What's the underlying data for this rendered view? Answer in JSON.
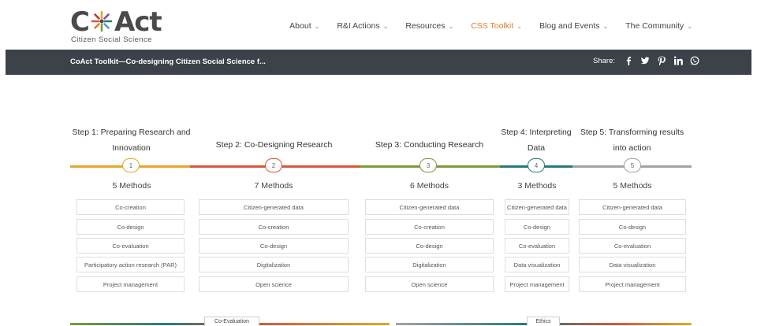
{
  "brand": {
    "name_pre": "C",
    "name_post": "Act",
    "subtitle": "Citizen Social Science"
  },
  "nav": [
    {
      "label": "About",
      "active": false
    },
    {
      "label": "R&I Actions",
      "active": false
    },
    {
      "label": "Resources",
      "active": false
    },
    {
      "label": "CSS Toolkit",
      "active": true
    },
    {
      "label": "Blog and Events",
      "active": false
    },
    {
      "label": "The Community",
      "active": false
    }
  ],
  "bar": {
    "title": "CoAct Toolkit—Co-designing Citizen Social Science f...",
    "share_label": "Share:",
    "share_icons": [
      "facebook-icon",
      "twitter-icon",
      "pinterest-icon",
      "linkedin-icon",
      "whatsapp-icon"
    ]
  },
  "steps": [
    {
      "title": "Step 1: Preparing Research and Innovation",
      "number": "1",
      "color": "#e3a82b",
      "methods": "5 Methods",
      "items": [
        "Co-creation",
        "Co-design",
        "Co-evaluation",
        "Participatory action research (PAR)",
        "Project management"
      ]
    },
    {
      "title": "Step 2: Co-Designing Research",
      "number": "2",
      "color": "#d9573b",
      "methods": "7 Methods",
      "items": [
        "Citizen-generated data",
        "Co-creation",
        "Co-design",
        "Digitalization",
        "Open science"
      ]
    },
    {
      "title": "Step 3: Conducting Research",
      "number": "3",
      "color": "#7d9a3c",
      "methods": "6 Methods",
      "items": [
        "Citizen-generated data",
        "Co-creation",
        "Co-design",
        "Digitalization",
        "Open science"
      ]
    },
    {
      "title": "Step 4: Interpreting Data",
      "number": "4",
      "color": "#2b7878",
      "methods": "3 Methods",
      "items": [
        "Citizen-generated data",
        "Co-design",
        "Co-evaluation",
        "Data visualization",
        "Project management"
      ]
    },
    {
      "title": "Step 5: Transforming results into action",
      "number": "5",
      "color": "#a3a3a3",
      "methods": "5 Methods",
      "items": [
        "Citizen-generated data",
        "Co-design",
        "Co-evaluation",
        "Data visualization",
        "Project management"
      ]
    }
  ],
  "bottom_tags": [
    {
      "label": "Co-Evaluation"
    },
    {
      "label": "Ethics"
    }
  ],
  "colors": {
    "accent": "#e07a2e",
    "bar_bg": "#3d4149",
    "step1": "#e3a82b",
    "step2": "#d9573b",
    "step3": "#7d9a3c",
    "step4": "#2b7878",
    "step5": "#a3a3a3"
  }
}
